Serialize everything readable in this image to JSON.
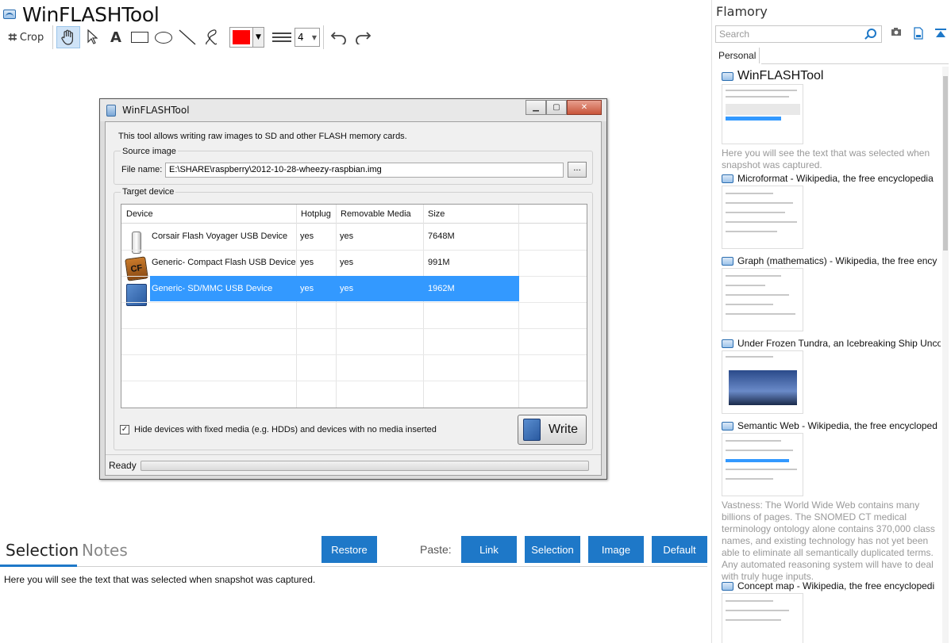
{
  "left": {
    "doc_title": "WinFLASHTool",
    "toolbar": {
      "crop_label": "Crop",
      "text_tool_label": "A",
      "line_width_value": "4",
      "stroke_color": "#ff0000"
    }
  },
  "screenshot_window": {
    "title": "WinFLASHTool",
    "intro": "This tool allows writing raw images to SD and other FLASH memory cards.",
    "source_label": "Source image",
    "file_name_label": "File name:",
    "file_path": "E:\\SHARE\\raspberry\\2012-10-28-wheezy-raspbian.img",
    "browse_label": "...",
    "target_label": "Target device",
    "columns": [
      "Device",
      "Hotplug",
      "Removable Media",
      "Size"
    ],
    "rows": [
      {
        "device": "Corsair Flash Voyager USB Device",
        "hotplug": "yes",
        "removable": "yes",
        "size": "7648M",
        "icon": "usb-drive-icon",
        "selected": false
      },
      {
        "device": "Generic- Compact Flash USB Device",
        "hotplug": "yes",
        "removable": "yes",
        "size": "991M",
        "icon": "compact-flash-icon",
        "icon_text": "CF",
        "selected": false
      },
      {
        "device": "Generic- SD/MMC USB Device",
        "hotplug": "yes",
        "removable": "yes",
        "size": "1962M",
        "icon": "sd-card-icon",
        "selected": true
      }
    ],
    "hide_devices_label": "Hide devices with fixed media (e.g. HDDs) and devices with no media inserted",
    "hide_devices_checked": true,
    "write_label": "Write",
    "status": "Ready"
  },
  "bottom": {
    "tab_selection": "Selection",
    "tab_notes": "Notes",
    "restore_label": "Restore",
    "paste_label": "Paste:",
    "paste_buttons": [
      "Link",
      "Selection",
      "Image",
      "Default"
    ],
    "selection_text": "Here you will see the text that was selected when snapshot was captured."
  },
  "sidebar": {
    "title": "Flamory",
    "search_placeholder": "Search",
    "tab_personal": "Personal",
    "snapshots": [
      {
        "title": "WinFLASHTool",
        "note": "Here you will see the text that was selected when snapshot was captured."
      },
      {
        "title": "Microformat - Wikipedia, the free encyclopedia",
        "note": ""
      },
      {
        "title": "Graph (mathematics) - Wikipedia, the free ency",
        "note": ""
      },
      {
        "title": "Under Frozen Tundra, an Icebreaking Ship Unco",
        "note": ""
      },
      {
        "title": "Semantic Web - Wikipedia, the free encycloped",
        "note": "Vastness: The World Wide Web contains many billions of pages. The SNOMED CT medical terminology ontology alone contains 370,000 class names, and existing technology has not yet been able to eliminate all semantically duplicated terms. Any automated reasoning system will have to deal with truly huge inputs."
      },
      {
        "title": "Concept map - Wikipedia, the free encyclopedi",
        "note": ""
      }
    ]
  },
  "colors": {
    "accent": "#1e78c8",
    "selection": "#3399ff",
    "muted_text": "#999999"
  }
}
